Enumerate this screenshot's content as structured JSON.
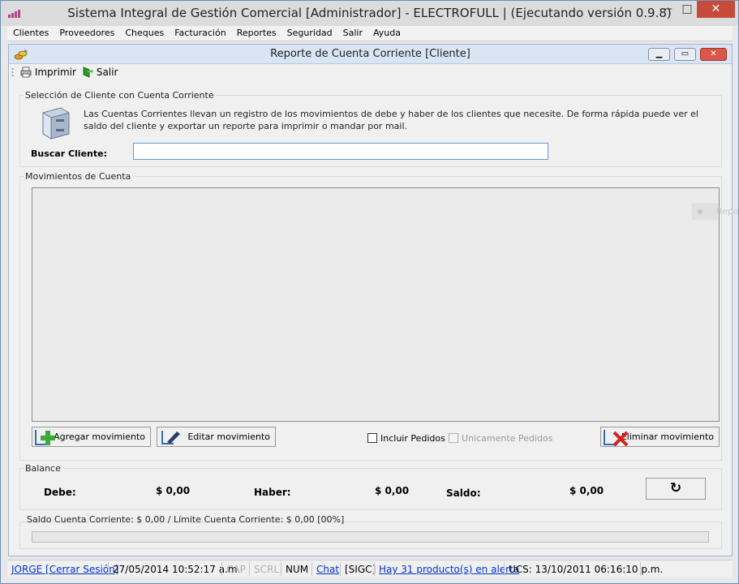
{
  "window": {
    "title": "Sistema Integral de Gestión Comercial [Administrador] - ELECTROFULL | (Ejecutando versión 0.9.8)",
    "min_symbol": "—",
    "max_symbol": "□",
    "close_symbol": "✕"
  },
  "menu": [
    "Clientes",
    "Proveedores",
    "Cheques",
    "Facturación",
    "Reportes",
    "Seguridad",
    "Salir",
    "Ayuda"
  ],
  "child": {
    "title": "Reporte de Cuenta Corriente [Cliente]"
  },
  "toolbar": {
    "print_label": "Imprimir",
    "exit_label": "Salir"
  },
  "client_section": {
    "label": "Selección de Cliente con Cuenta Corriente",
    "info": "Las Cuentas Corrientes llevan un registro de los movimientos de debe y haber de los clientes que necesite. De forma rápida puede ver el saldo del cliente y exportar un reporte para imprimir o mandar por mail.",
    "search_label": "Buscar Cliente:",
    "search_value": ""
  },
  "movements": {
    "label": "Movimientos de Cuenta",
    "add_label": "Agregar movimiento",
    "edit_label": "Editar movimiento",
    "include_orders": "Incluir Pedidos",
    "only_orders": "Unicamente Pedidos",
    "delete_label": "Eliminar movimiento"
  },
  "balance": {
    "label": "Balance",
    "debe_label": "Debe:",
    "debe_value": "$ 0,00",
    "haber_label": "Haber:",
    "haber_value": "$ 0,00",
    "saldo_label": "Saldo:",
    "saldo_value": "$ 0,00"
  },
  "account": {
    "summary": "Saldo Cuenta Corriente: $ 0,00 / Límite Cuenta Corriente: $ 0,00 [00%]",
    "progress": 0
  },
  "floating_tip": "Repo",
  "status": {
    "user": "JORGE [Cerrar Sesión]",
    "datetime": "27/05/2014 10:52:17 a.m.",
    "cap": "CAP",
    "scrl": "SCRL",
    "num": "NUM",
    "chat": "Chat",
    "sigc": "[SIGC]",
    "alert": "Hay 31 producto(s) en alerta",
    "ucs": "UCS: 13/10/2011 06:16:10 p.m."
  },
  "colors": {
    "accent": "#5e9bd6",
    "link": "#0033cc",
    "close": "#c74b3b"
  }
}
